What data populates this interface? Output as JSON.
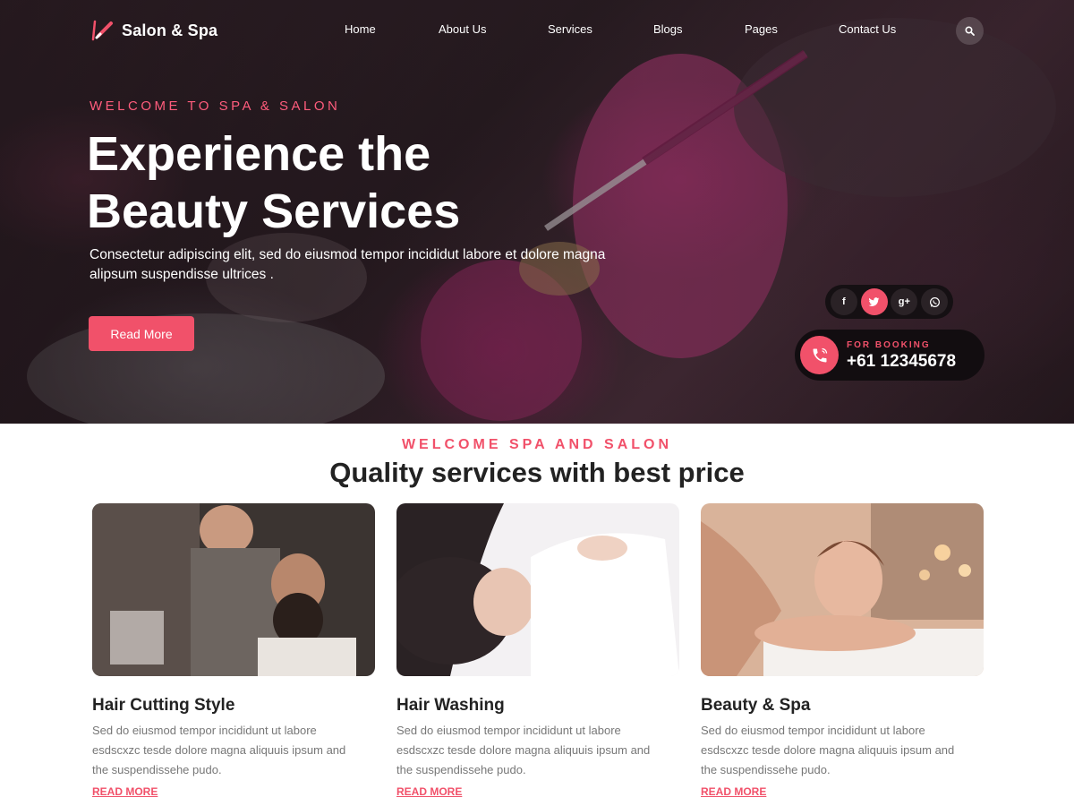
{
  "brand": {
    "name": "Salon & Spa",
    "accent": "#f1516a"
  },
  "nav": {
    "items": [
      "Home",
      "About Us",
      "Services",
      "Blogs",
      "Pages",
      "Contact Us"
    ],
    "search_icon": "search-icon"
  },
  "hero": {
    "eyebrow": "WELCOME TO SPA & SALON",
    "title_line1": "Experience the",
    "title_line2": "Beauty Services",
    "text": "Consectetur adipiscing elit, sed do eiusmod tempor incididut labore et dolore magna alipsum suspendisse ultrices .",
    "button_label": "Read More"
  },
  "social": {
    "icons": [
      "facebook-icon",
      "twitter-icon",
      "google-plus-icon",
      "whatsapp-icon"
    ],
    "facebook_glyph": "f",
    "google_glyph": "g+"
  },
  "booking": {
    "label": "FOR BOOKING",
    "phone": "+61 12345678",
    "icon": "phone-icon"
  },
  "services_section": {
    "eyebrow": "WELCOME SPA AND SALON",
    "title": "Quality services with best price"
  },
  "cards": [
    {
      "title": "Hair Cutting Style",
      "text": "Sed do eiusmod tempor incididunt ut labore esdscxzc tesde dolore magna aliquuis ipsum and the suspendissehe pudo.",
      "link": "READ MORE"
    },
    {
      "title": "Hair Washing",
      "text": "Sed do eiusmod tempor incididunt ut labore esdscxzc tesde dolore magna aliquuis ipsum and the suspendissehe pudo.",
      "link": "READ MORE"
    },
    {
      "title": "Beauty & Spa",
      "text": "Sed do eiusmod tempor incididunt ut labore esdscxzc tesde dolore magna aliquuis ipsum and the suspendissehe pudo.",
      "link": "READ MORE"
    }
  ]
}
